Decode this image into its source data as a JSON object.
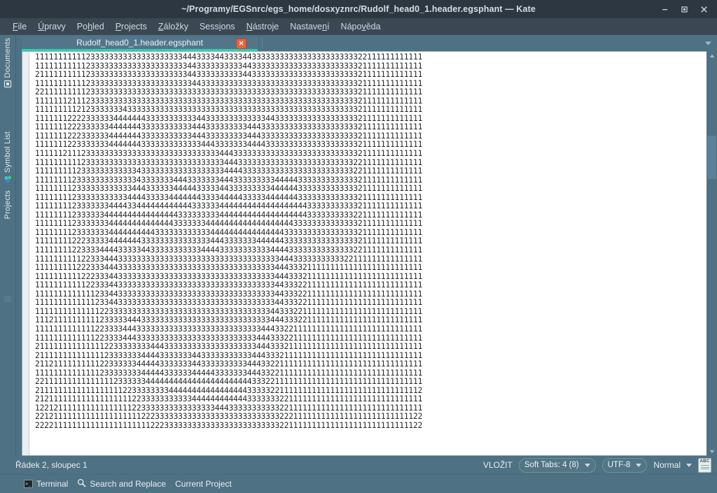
{
  "titlebar": {
    "title": "~/Programy/EGSnrc/egs_home/dosxyznrc/Rudolf_head0_1.header.egsphant  —  Kate",
    "minimize": "–",
    "maximize": "□",
    "close": "✕"
  },
  "menubar": {
    "items": [
      {
        "label": "File",
        "mnemonic_index": 0
      },
      {
        "label": "Úpravy",
        "mnemonic_index": 0
      },
      {
        "label": "Pohled",
        "mnemonic_index": 2
      },
      {
        "label": "Projects",
        "mnemonic_index": 0
      },
      {
        "label": "Záložky",
        "mnemonic_index": 0
      },
      {
        "label": "Sessions",
        "mnemonic_index": 4
      },
      {
        "label": "Nástroje",
        "mnemonic_index": 0
      },
      {
        "label": "Nastavení",
        "mnemonic_index": 6
      },
      {
        "label": "Nápověda",
        "mnemonic_index": 4
      }
    ]
  },
  "sidebar": {
    "items": [
      {
        "label": "Documents",
        "icon": "documents-icon"
      },
      {
        "label": "Symbol List",
        "icon": "symbol-list-icon"
      },
      {
        "label": "Projects",
        "icon": "projects-icon"
      }
    ]
  },
  "tabbar": {
    "tabs": [
      {
        "label": "Rudolf_head0_1.header.egsphant",
        "close_label": "✕",
        "active": true
      }
    ],
    "dropdown_icon": "chevron-down-icon"
  },
  "editor": {
    "lines": [
      "111111111112333333333333333333334443333443333443333333333333333333333322111111111111",
      "111111111112333333333333333333333443333333333443333333333333333333333321111111111111",
      "211111111112333333333333333333333443333333333443333333333333333333333321111111111111",
      "111111111112333333333333333333333344333333333333333333333333333333333321111111111111",
      "221111111112333333333333333333333333333333333333333333333333333333333321111111111111",
      "111111121112333333333333333333333333333333333333333333333333333333333321111111111111",
      "111111111212333333343333333333333333333333333333333333333333333333333321111111111111",
      "111111122223333334444444333333333334433333333333334433333333333333333321111111111111",
      "111111122233333344444443333333333344433333333344433333333333333333333321111111111111",
      "111111122233333344444443333333333344433333333344433333333333333333333321111111111111",
      "111111122333333344444443333333333333444333333344443333333333333333333321111111111111",
      "111111211123333333333333333333333333333344433333333333333333333333333321111111111111",
      "111111111123333333333333333333333333333334443333333333333333333333333221111111111111",
      "111111111233333333333343333333333333333334444333333333333333333333333221111111111111",
      "111111112333333333333343333333444333333344433333333344444333333333333321111111111111",
      "111111112333333333333444333333444443333344333333333444444333333333333321111111111111",
      "111111112333333333334444333334444444333344444333334444444333333333333321111111111111",
      "111111112333333344443344444444444433333344444444444444444443333333333321111111111111",
      "111111112333333444444444444444433333333344444444444444444443333333333221111111111111",
      "111111112333333344444444444444333333344444444444444444443333333333333321111111111111",
      "111111112333333344444444443333333333334444444444444444333333333333333321111111111111",
      "111111112223333344444443333333333333334443333333444444333333333333333321111111111111",
      "111111112233334444333334433333333333444433333333333444433333333333333221111111111111",
      "111111111122333444333333333333333333333333333333333334443333333333322111111111111111",
      "111111111222333444333333333333333333333333333333333344433321111111111111111111111111",
      "111111111122233344333333333333333333333333333333333344433321111111111111111111111111",
      "111111111112233344333333333333333333333333333333333344333221111111111111111111111111",
      "111111111111123344333333333333333333333333333333333344333221111111111111111111111111",
      "111111111111123344333333333333333333333333333333333344333221111111111111111111111111",
      "111111111111112233333333333333333333333333333333333443332211111111111111111111111111",
      "111211111111112333334443333333333333333333333333333444333221111111111111111111111111",
      "111111111111122333344433333333333333333333333333344433221111111111111111111111111111",
      "111111111111122333344433333333333333333333333333444333221111111111111111111111111111",
      "211111111111111223333333344433333333333333333333444333211111111111111111111111111111",
      "211111111111111233333334444333333344333333333334443332111111111111111111111111111111",
      "211211111111112233333344444333333344333333333344433221111111111111111111111111111111",
      "111111111111112333333334444433333344444333333344433221111111111111111111111111111111",
      "221111111111111112333333444444444444444444444443332211111111111111111111111111111111",
      "211111111111111111122333333334444444444444444433333221111111111111111111111111111112",
      "212111111111111111111223333333333344444444444433333332211111111111111111111111111111",
      "122121111111111111111223333333333333333444333333333332211111111111111111111111111111",
      "221211111111111111111112223333333333333333333333333332221111111111111111111111111122",
      "222211111111111111111111122233333333333333333333333332211111111111111111111111111122"
    ]
  },
  "scrollbar": {
    "up_icon": "scroll-up-icon",
    "down_icon": "scroll-down-icon"
  },
  "statusbar": {
    "cursor_position": "Řádek 2, sloupec 1",
    "insert_mode": "VLOŽIT",
    "tab_setting": "Soft Tabs: 4 (8)",
    "encoding": "UTF-8",
    "mode": "Normal",
    "spellcheck_icon_label": "ABC"
  },
  "bottombar": {
    "items": [
      {
        "label": "Terminal",
        "icon": "terminal-icon"
      },
      {
        "label": "Search and Replace",
        "icon": "search-icon"
      },
      {
        "label": "Current Project",
        "icon": ""
      }
    ]
  },
  "colors": {
    "titlebar_bg": "#2c3742",
    "menubar_bg": "#3b4853",
    "chrome_bg": "#4e7183",
    "tab_accent": "#2ecfae",
    "tab_close": "#e8643c",
    "editor_bg": "#ffffff",
    "editor_text": "#232629"
  }
}
